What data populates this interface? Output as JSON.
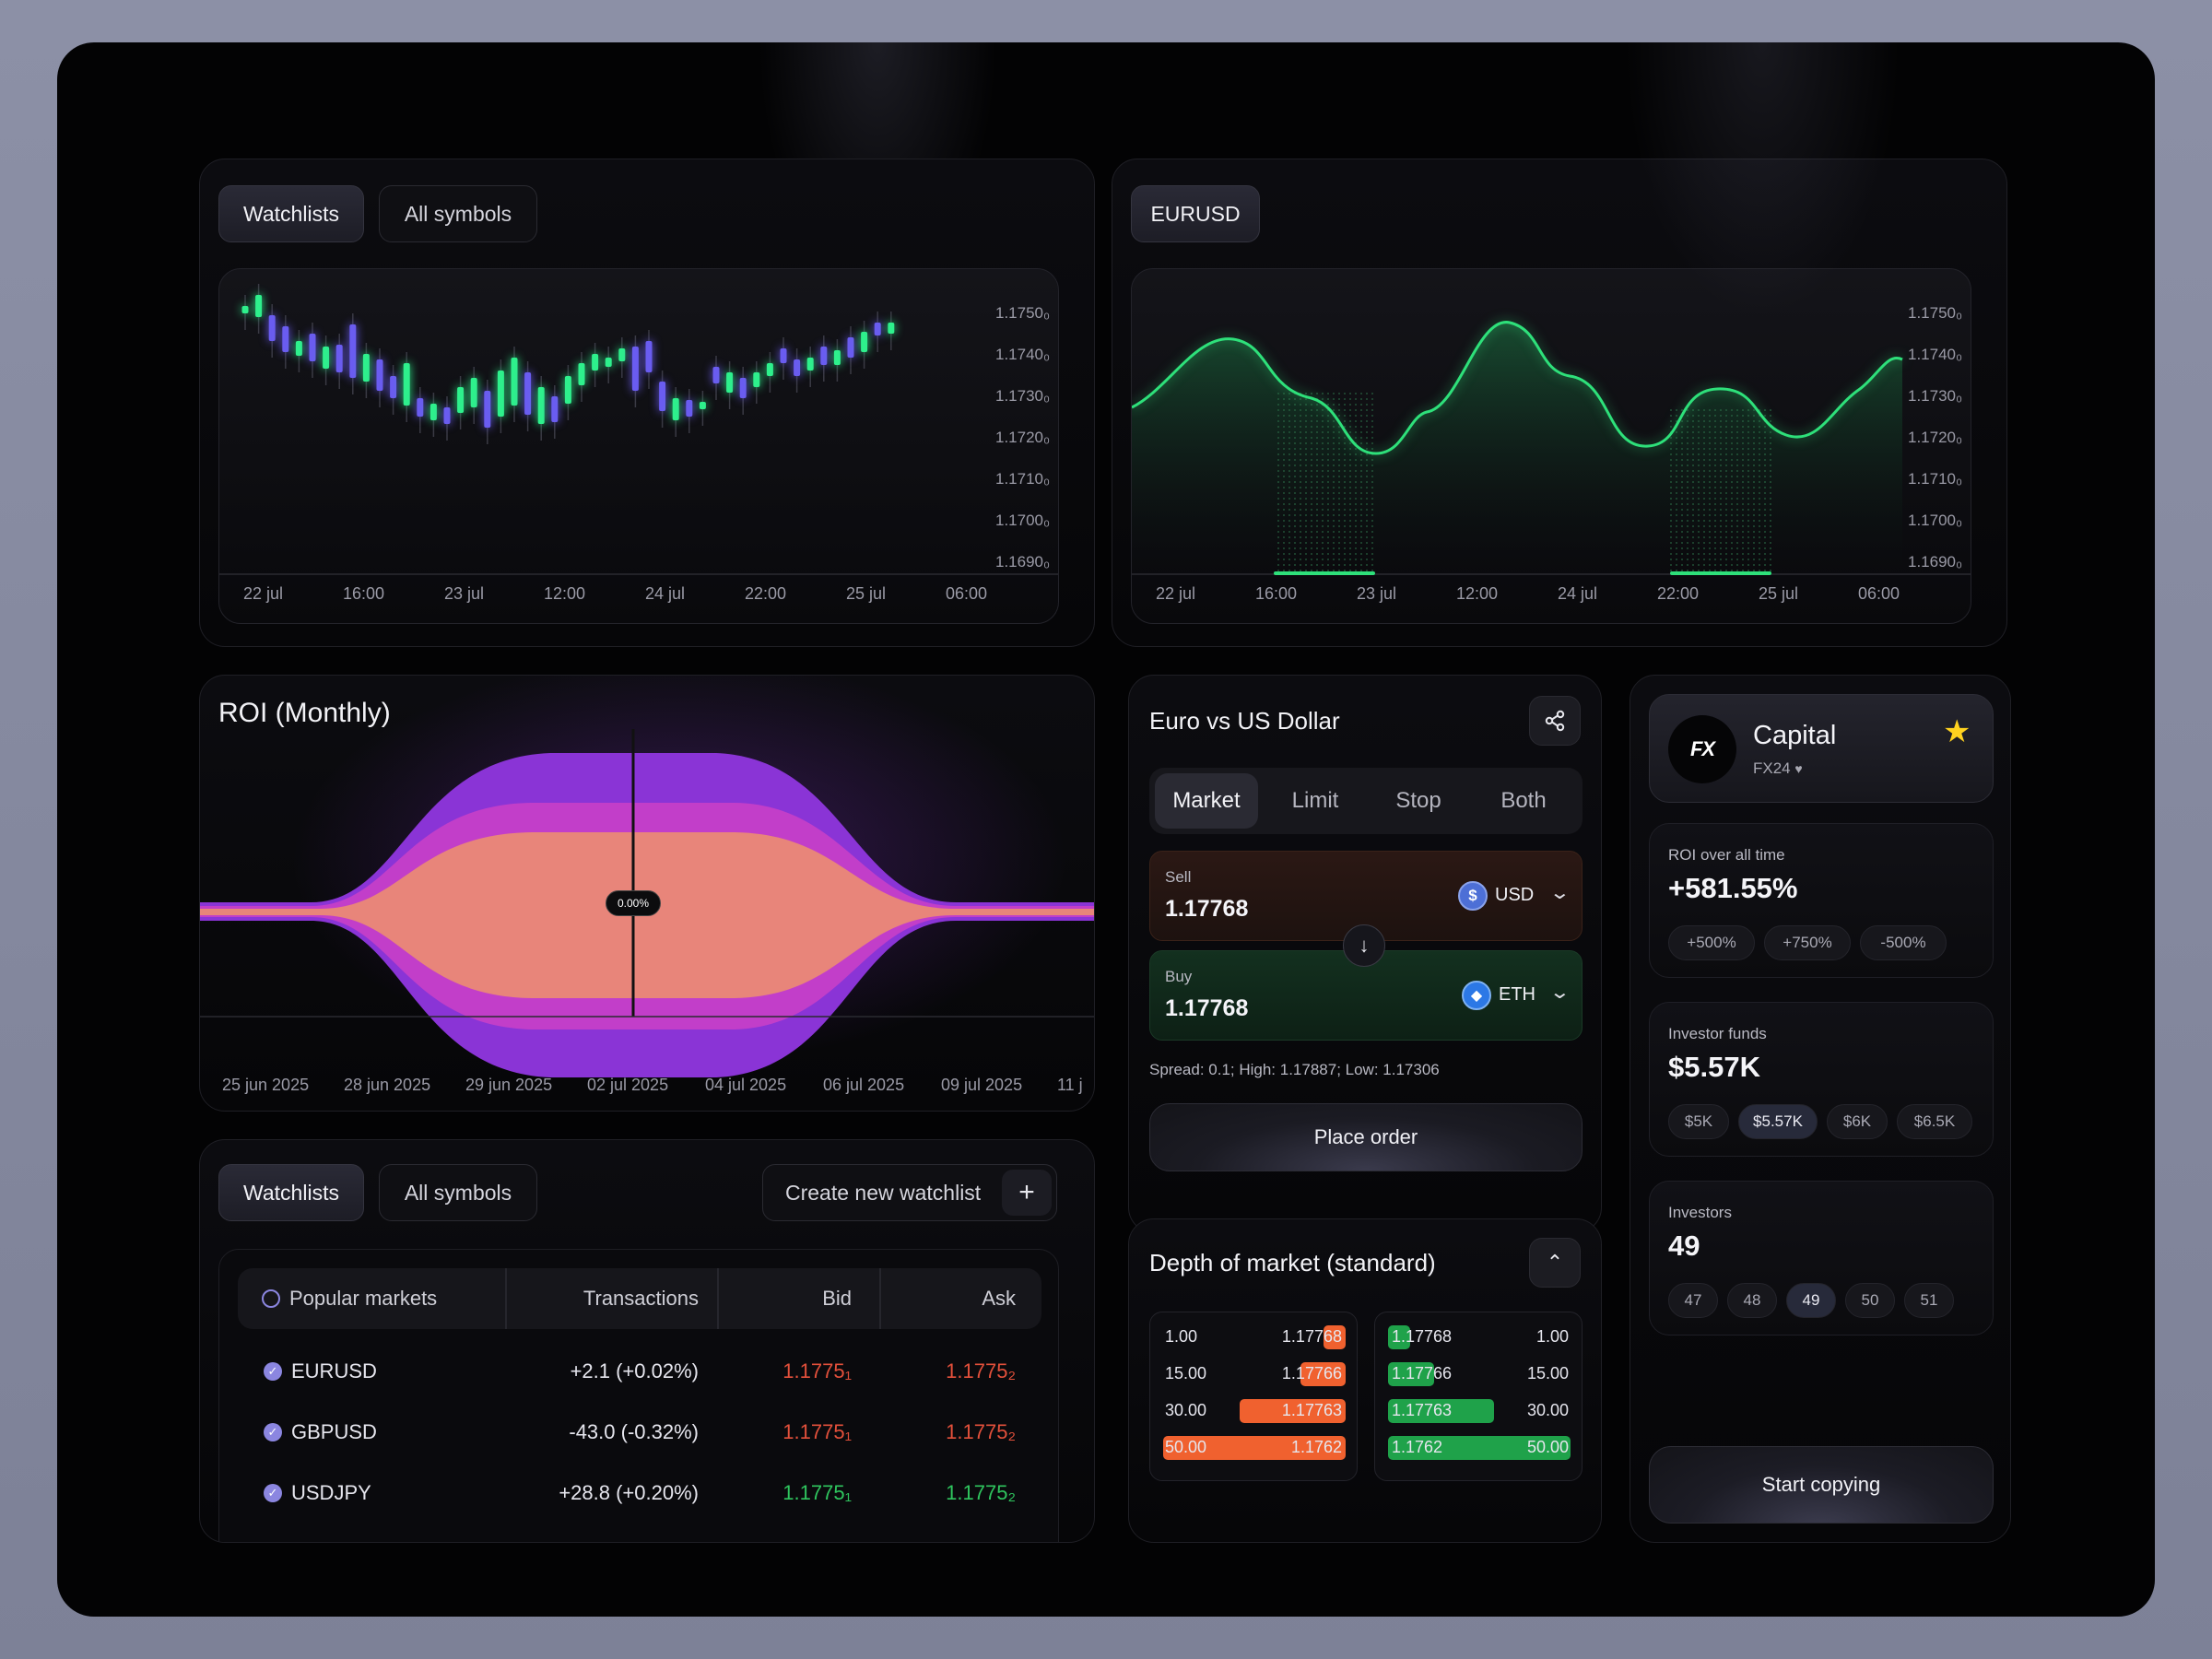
{
  "watchlist_chart": {
    "tabs": [
      "Watchlists",
      "All symbols"
    ],
    "y_labels": [
      "1.1750₀",
      "1.1740₀",
      "1.1730₀",
      "1.1720₀",
      "1.1710₀",
      "1.1700₀",
      "1.1690₀"
    ],
    "x_labels": [
      "22 jul",
      "16:00",
      "23 jul",
      "12:00",
      "24 jul",
      "22:00",
      "25 jul",
      "06:00"
    ]
  },
  "eurusd_chart": {
    "tab": "EURUSD",
    "y_labels": [
      "1.1750₀",
      "1.1740₀",
      "1.1730₀",
      "1.1720₀",
      "1.1710₀",
      "1.1700₀",
      "1.1690₀"
    ],
    "x_labels": [
      "22 jul",
      "16:00",
      "23 jul",
      "12:00",
      "24 jul",
      "22:00",
      "25 jul",
      "06:00"
    ]
  },
  "roi_chart": {
    "title": "ROI (Monthly)",
    "marker_value": "0.00%",
    "x_labels": [
      "25 jun 2025",
      "28 jun 2025",
      "29 jun 2025",
      "02 jul 2025",
      "04 jul 2025",
      "06 jul 2025",
      "09 jul 2025",
      "11 j"
    ],
    "colors": {
      "core": "#e8857a",
      "mid": "#c23ec9",
      "outer": "#8a34d6"
    }
  },
  "watchlist_table": {
    "tabs": [
      "Watchlists",
      "All symbols"
    ],
    "create_label": "Create new watchlist",
    "headers": {
      "market": "Popular markets",
      "transactions": "Transactions",
      "bid": "Bid",
      "ask": "Ask"
    },
    "rows": [
      {
        "symbol": "EURUSD",
        "transactions": "+2.1 (+0.02%)",
        "bid": "1.1775₁",
        "ask": "1.1775₂",
        "trend": "down"
      },
      {
        "symbol": "GBPUSD",
        "transactions": "-43.0 (-0.32%)",
        "bid": "1.1775₁",
        "ask": "1.1775₂",
        "trend": "down"
      },
      {
        "symbol": "USDJPY",
        "transactions": "+28.8 (+0.20%)",
        "bid": "1.1775₁",
        "ask": "1.1775₂",
        "trend": "up"
      }
    ]
  },
  "order": {
    "title": "Euro vs US Dollar",
    "share_icon": "share-icon",
    "tabs": [
      "Market",
      "Limit",
      "Stop",
      "Both"
    ],
    "sell": {
      "label": "Sell",
      "value": "1.17768",
      "currency": "USD"
    },
    "buy": {
      "label": "Buy",
      "value": "1.17768",
      "currency": "ETH"
    },
    "spread": "Spread: 0.1; High: 1.17887; Low: 1.17306",
    "place_label": "Place order",
    "colors": {
      "sell_bg": "#2a1814",
      "buy_bg": "#10281a"
    }
  },
  "depth": {
    "title": "Depth of market (standard)",
    "left": [
      {
        "qty": "1.00",
        "price": "1.17768",
        "fill": 0.12
      },
      {
        "qty": "15.00",
        "price": "1.17766",
        "fill": 0.25
      },
      {
        "qty": "30.00",
        "price": "1.17763",
        "fill": 0.58
      },
      {
        "qty": "50.00",
        "price": "1.1762",
        "fill": 1.0
      }
    ],
    "right": [
      {
        "price": "1.17768",
        "qty": "1.00",
        "fill": 0.12
      },
      {
        "price": "1.17766",
        "qty": "15.00",
        "fill": 0.25
      },
      {
        "price": "1.17763",
        "qty": "30.00",
        "fill": 0.58
      },
      {
        "price": "1.1762",
        "qty": "50.00",
        "fill": 1.0
      }
    ],
    "colors": {
      "sell": "#f0612f",
      "buy": "#1fa24a"
    }
  },
  "capital": {
    "name": "Capital",
    "sub": "FX24",
    "logo_text": "FX",
    "roi_label": "ROI over all time",
    "roi_value": "+581.55%",
    "roi_chips": [
      "+500%",
      "+750%",
      "-500%"
    ],
    "funds_label": "Investor funds",
    "funds_value": "$5.57K",
    "funds_chips": [
      "$5K",
      "$5.57K",
      "$6K",
      "$6.5K"
    ],
    "investors_label": "Investors",
    "investors_value": "49",
    "investors_chips": [
      "47",
      "48",
      "49",
      "50",
      "51"
    ],
    "start_label": "Start copying"
  }
}
